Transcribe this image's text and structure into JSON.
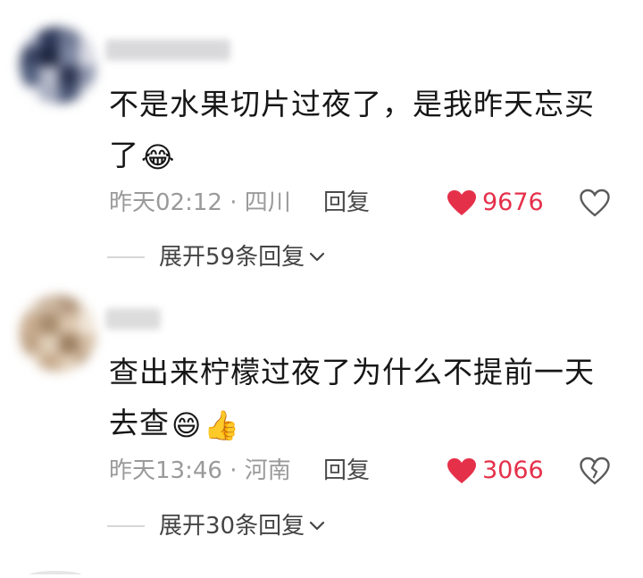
{
  "comments": [
    {
      "text": "不是水果切片过夜了，是我昨天忘买了",
      "emojis": [
        "😂"
      ],
      "time": "昨天02:12",
      "separator": "·",
      "location": "四川",
      "reply_label": "回复",
      "likes": "9676",
      "liked": true,
      "like_color": "#e5304a",
      "expand_label": "展开59条回复",
      "expand_icon": "chevron-down-icon",
      "avatar_colors": [
        "#9aa1b8",
        "#2f3a5a",
        "#6f7893",
        "#c8cad6",
        "#3c4766",
        "#1f2740",
        "#7c85a0",
        "#d8d9e2",
        "#52607f",
        "#b5b9c8",
        "#2b3350",
        "#8d95ad",
        "#e3e4ea",
        "#a7adc0",
        "#4b5776",
        "#c2c6d2"
      ],
      "username_color": "#d9d9dc"
    },
    {
      "text": "查出来柠檬过夜了为什么不提前一天去查",
      "emojis": [
        "😄",
        "👍"
      ],
      "time": "昨天13:46",
      "separator": "·",
      "location": "河南",
      "reply_label": "回复",
      "likes": "3066",
      "liked": true,
      "like_color": "#e5304a",
      "expand_label": "展开30条回复",
      "expand_icon": "chevron-down-icon",
      "avatar_colors": [
        "#d9c8b6",
        "#cbb59e",
        "#b59a80",
        "#e8dccd",
        "#c9ad90",
        "#a68a6c",
        "#dcc6ad",
        "#f0e6d9",
        "#bfa386",
        "#e1cfb9",
        "#9c7f62",
        "#d4bda3",
        "#efe4d6",
        "#c6ab8e",
        "#dfccb4",
        "#b3977a"
      ],
      "username_color": "#dcdcdc"
    }
  ]
}
